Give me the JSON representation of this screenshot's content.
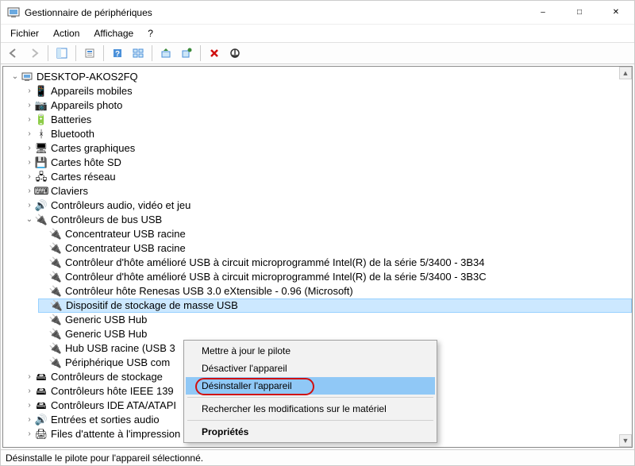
{
  "window": {
    "title": "Gestionnaire de périphériques"
  },
  "menu": {
    "file": "Fichier",
    "action": "Action",
    "view": "Affichage",
    "help": "?"
  },
  "tree": {
    "root": "DESKTOP-AKOS2FQ",
    "items": [
      {
        "icon": "📱",
        "label": "Appareils mobiles"
      },
      {
        "icon": "📷",
        "label": "Appareils photo"
      },
      {
        "icon": "🔋",
        "label": "Batteries"
      },
      {
        "icon": "ᚼ",
        "label": "Bluetooth"
      },
      {
        "icon": "🖥",
        "label": "Cartes graphiques"
      },
      {
        "icon": "💾",
        "label": "Cartes hôte SD"
      },
      {
        "icon": "🖧",
        "label": "Cartes réseau"
      },
      {
        "icon": "⌨",
        "label": "Claviers"
      },
      {
        "icon": "🔊",
        "label": "Contrôleurs audio, vidéo et jeu"
      }
    ],
    "usb": {
      "label": "Contrôleurs de bus USB",
      "children": [
        "Concentrateur USB racine",
        "Concentrateur USB racine",
        "Contrôleur d'hôte amélioré USB à circuit microprogrammé Intel(R) de la série 5/3400 - 3B34",
        "Contrôleur d'hôte amélioré USB à circuit microprogrammé Intel(R) de la série 5/3400 - 3B3C",
        "Contrôleur hôte Renesas USB 3.0 eXtensible - 0.96 (Microsoft)",
        "Dispositif de stockage de masse USB",
        "Generic USB Hub",
        "Generic USB Hub",
        "Hub USB racine (USB 3",
        "Périphérique USB com"
      ],
      "selected_index": 5
    },
    "after": [
      {
        "icon": "🖴",
        "label": "Contrôleurs de stockage"
      },
      {
        "icon": "🖴",
        "label": "Contrôleurs hôte IEEE 139"
      },
      {
        "icon": "🖴",
        "label": "Contrôleurs IDE ATA/ATAPI"
      },
      {
        "icon": "🔊",
        "label": "Entrées et sorties audio"
      },
      {
        "icon": "🖨",
        "label": "Files d'attente à l'impression"
      }
    ]
  },
  "context_menu": {
    "update": "Mettre à jour le pilote",
    "disable": "Désactiver l'appareil",
    "uninstall": "Désinstaller l'appareil",
    "scan": "Rechercher les modifications sur le matériel",
    "properties": "Propriétés"
  },
  "status": "Désinstalle le pilote pour l'appareil sélectionné."
}
